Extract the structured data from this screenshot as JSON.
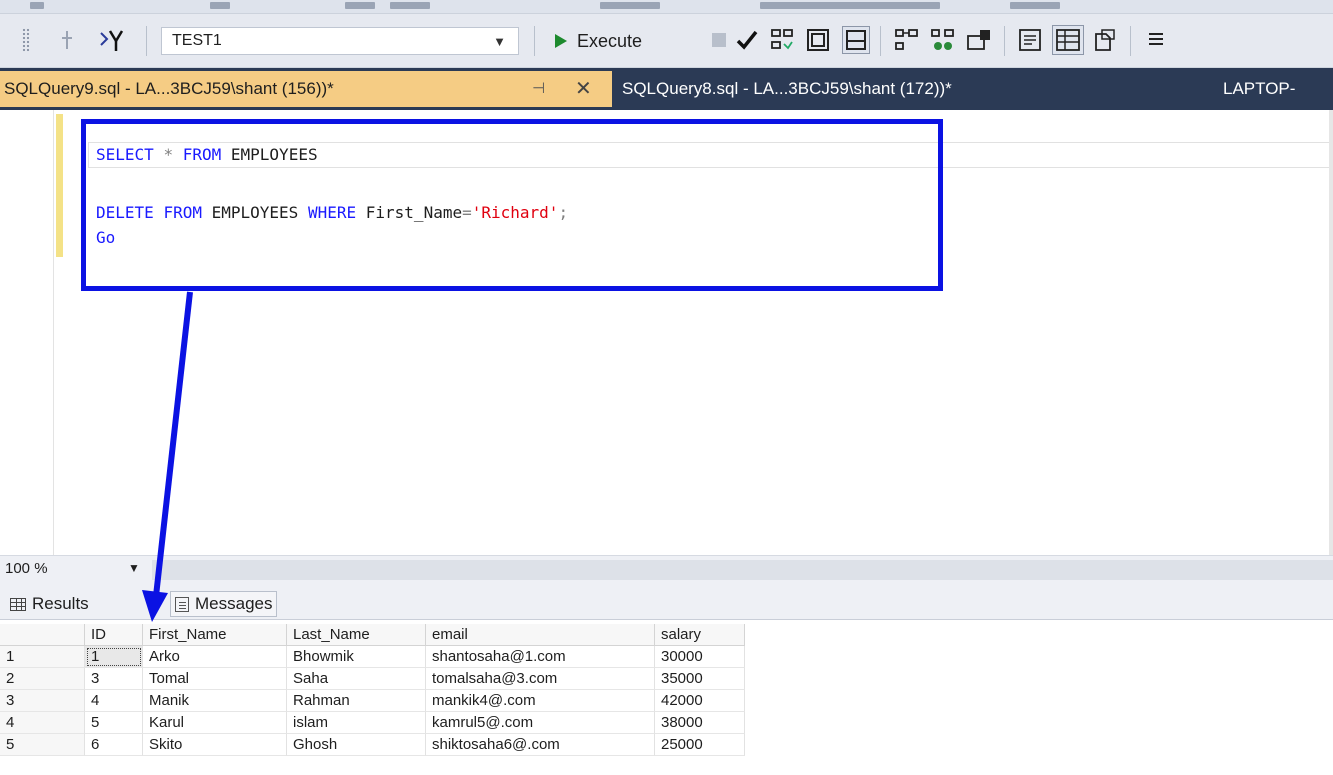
{
  "toolbar": {
    "database": "TEST1",
    "execute_label": "Execute"
  },
  "tabs": {
    "active_label": "SQLQuery9.sql - LA...3BCJ59\\shant (156))*",
    "inactive_label": "SQLQuery8.sql - LA...3BCJ59\\shant (172))*",
    "server_label": "LAPTOP-"
  },
  "editor": {
    "line1": {
      "kw1": "SELECT",
      "op": "*",
      "kw2": "FROM",
      "table": "EMPLOYEES"
    },
    "line3": {
      "kw1": "DELETE",
      "kw2": "FROM",
      "table": "EMPLOYEES",
      "kw3": "WHERE",
      "column": "First_Name",
      "eq": "=",
      "value": "'Richard'",
      "semi": ";"
    },
    "line4": {
      "kw": "Go"
    }
  },
  "zoom": {
    "value": "100 %"
  },
  "results_tabs": {
    "results_label": "Results",
    "messages_label": "Messages"
  },
  "grid": {
    "columns": [
      "ID",
      "First_Name",
      "Last_Name",
      "email",
      "salary"
    ],
    "rows": [
      {
        "rn": "1",
        "cells": [
          "1",
          "Arko",
          "Bhowmik",
          "shantosaha@1.com",
          "30000"
        ]
      },
      {
        "rn": "2",
        "cells": [
          "3",
          "Tomal",
          "Saha",
          "tomalsaha@3.com",
          "35000"
        ]
      },
      {
        "rn": "3",
        "cells": [
          "4",
          "Manik",
          "Rahman",
          "mankik4@.com",
          "42000"
        ]
      },
      {
        "rn": "4",
        "cells": [
          "5",
          "Karul",
          "islam",
          "kamrul5@.com",
          "38000"
        ]
      },
      {
        "rn": "5",
        "cells": [
          "6",
          "Skito",
          "Ghosh",
          "shiktosaha6@.com",
          "25000"
        ]
      }
    ]
  },
  "colors": {
    "annotation": "#0b12e3",
    "active_tab": "#f5cc84",
    "tab_strip": "#2b3a55",
    "keyword": "#1a1aff",
    "string": "#e0000f"
  }
}
